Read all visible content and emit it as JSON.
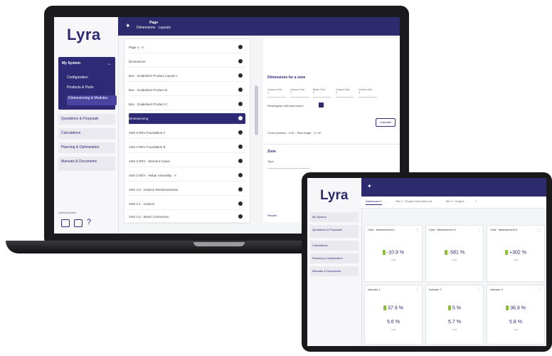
{
  "laptop": {
    "logo": "Lyra",
    "logo_sub": "",
    "header": {
      "title_line1": "Page",
      "title_line2": "Dimensions · Layouts"
    },
    "sidebar": {
      "selected_group": "My System",
      "selected_items": [
        "Configuration",
        "Products & Parts",
        "Dimensioning & Modules"
      ],
      "items": [
        {
          "label": "Quotations & Proposals"
        },
        {
          "label": "Calculations"
        },
        {
          "label": "Planning & Optimization"
        },
        {
          "label": "Manuals & Documents"
        }
      ],
      "footer_label": "Administration"
    },
    "tree": {
      "rows": [
        {
          "label": "Page 1 - A"
        },
        {
          "label": "Dimensions"
        },
        {
          "label": "Box · Guidelines Product Layout A"
        },
        {
          "label": "Box · Guidelines Product B"
        },
        {
          "label": "Box · Guidelines Product C"
        },
        {
          "label": "Dimensioning"
        },
        {
          "label": "ANS 2 REV Foundation A"
        },
        {
          "label": "ANS 2 REV Foundation B"
        },
        {
          "label": "ANS 2 REV · Element Cases"
        },
        {
          "label": "ANS 2 REV · Rebar Assembly · A"
        },
        {
          "label": "ANS 2.0 · Column Reinforcements"
        },
        {
          "label": "ANS 2.1 · Column"
        },
        {
          "label": "ANS 2.0 · Beam Connection"
        }
      ]
    },
    "panel": {
      "section_title": "Dimensions for a zone",
      "fields": [
        {
          "label": "Column Grid",
          "value": "1"
        },
        {
          "label": "Column Grid",
          "value": "1"
        },
        {
          "label": "Beam Grid",
          "value": "4"
        },
        {
          "label": "Column Dist.",
          "value": "1"
        },
        {
          "label": "Column Dist.",
          "value": "4"
        }
      ],
      "checkbox_label": "Rectangular with dimension?",
      "calc_button": "Calculate",
      "result_text": "Cross sections · 0.00 · Total length · 27 m²",
      "section2_title": "Zone",
      "section2_value": "Type",
      "bottom_label": "Results"
    }
  },
  "tablet": {
    "logo": "Lyra",
    "logo_sub": "",
    "sidebar": [
      {
        "label": "My System"
      },
      {
        "label": "Quotations & Proposals"
      },
      {
        "label": "Calculations"
      },
      {
        "label": "Planning & Optimization"
      },
      {
        "label": "Manuals & Documents"
      }
    ],
    "tabs": [
      {
        "label": "Dashboard 1"
      },
      {
        "label": "Tab 2 · Project Overview List"
      },
      {
        "label": "Tab 3 · Graphs"
      },
      {
        "label": "+"
      }
    ],
    "cards": [
      {
        "title": "Card · Measurement 1",
        "value": "-10.9 %",
        "caption": "Total"
      },
      {
        "title": "Card · Measurement 2",
        "value": "-581 %",
        "caption": "Total"
      },
      {
        "title": "Card · Measurement 3",
        "value": "+302 %",
        "caption": "Total"
      },
      {
        "title": "Indicator 1",
        "value": "37.9 %",
        "value2": "5.6 %",
        "caption": "Total"
      },
      {
        "title": "Indicator 2",
        "value": "5 %",
        "value2": "5.7 %",
        "caption": "Total"
      },
      {
        "title": "Indicator 3",
        "value": "36.9 %",
        "value2": "5.8 %",
        "caption": "Total"
      }
    ]
  }
}
